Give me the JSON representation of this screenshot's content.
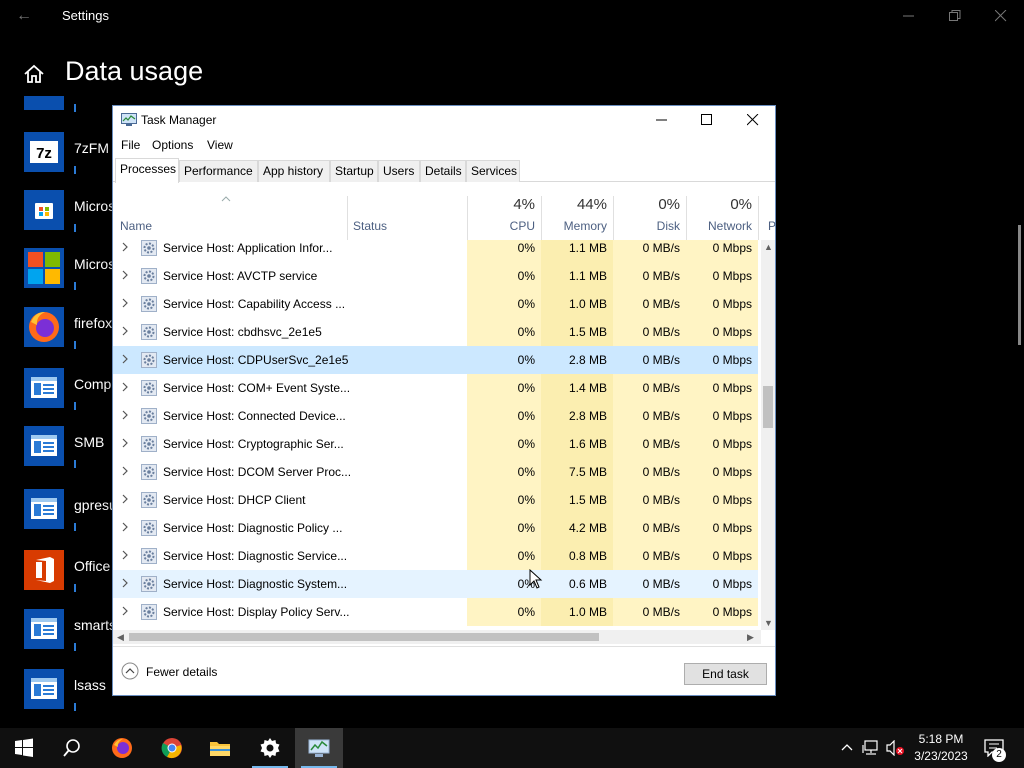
{
  "settings": {
    "title": "Settings",
    "heading": "Data usage",
    "apps": [
      {
        "name": "7zFM",
        "icon": "7zip-icon"
      },
      {
        "name": "Micros",
        "icon": "microsoft-store-icon"
      },
      {
        "name": "Micros",
        "icon": "microsoft-logo-icon"
      },
      {
        "name": "firefox",
        "icon": "firefox-icon"
      },
      {
        "name": "Comp",
        "icon": "generic-app-icon"
      },
      {
        "name": "SMB",
        "icon": "generic-app-icon"
      },
      {
        "name": "gpresu",
        "icon": "generic-app-icon"
      },
      {
        "name": "Office",
        "icon": "office-icon"
      },
      {
        "name": "smarts",
        "icon": "generic-app-icon"
      },
      {
        "name": "lsass",
        "icon": "generic-app-icon"
      }
    ]
  },
  "taskmgr": {
    "title": "Task Manager",
    "menu": [
      "File",
      "Options",
      "View"
    ],
    "tabs": [
      "Processes",
      "Performance",
      "App history",
      "Startup",
      "Users",
      "Details",
      "Services"
    ],
    "active_tab": "Processes",
    "columns": {
      "name": "Name",
      "status": "Status",
      "cpu": {
        "pct": "4%",
        "label": "CPU"
      },
      "memory": {
        "pct": "44%",
        "label": "Memory"
      },
      "disk": {
        "pct": "0%",
        "label": "Disk"
      },
      "network": {
        "pct": "0%",
        "label": "Network"
      },
      "power_partial": "P"
    },
    "rows": [
      {
        "name": "Service Host: Application Infor...",
        "cpu": "0%",
        "memory": "1.1 MB",
        "disk": "0 MB/s",
        "network": "0 Mbps"
      },
      {
        "name": "Service Host: AVCTP service",
        "cpu": "0%",
        "memory": "1.1 MB",
        "disk": "0 MB/s",
        "network": "0 Mbps"
      },
      {
        "name": "Service Host: Capability Access ...",
        "cpu": "0%",
        "memory": "1.0 MB",
        "disk": "0 MB/s",
        "network": "0 Mbps"
      },
      {
        "name": "Service Host: cbdhsvc_2e1e5",
        "cpu": "0%",
        "memory": "1.5 MB",
        "disk": "0 MB/s",
        "network": "0 Mbps"
      },
      {
        "name": "Service Host: CDPUserSvc_2e1e5",
        "cpu": "0%",
        "memory": "2.8 MB",
        "disk": "0 MB/s",
        "network": "0 Mbps",
        "state": "selected"
      },
      {
        "name": "Service Host: COM+ Event Syste...",
        "cpu": "0%",
        "memory": "1.4 MB",
        "disk": "0 MB/s",
        "network": "0 Mbps"
      },
      {
        "name": "Service Host: Connected Device...",
        "cpu": "0%",
        "memory": "2.8 MB",
        "disk": "0 MB/s",
        "network": "0 Mbps"
      },
      {
        "name": "Service Host: Cryptographic Ser...",
        "cpu": "0%",
        "memory": "1.6 MB",
        "disk": "0 MB/s",
        "network": "0 Mbps"
      },
      {
        "name": "Service Host: DCOM Server Proc...",
        "cpu": "0%",
        "memory": "7.5 MB",
        "disk": "0 MB/s",
        "network": "0 Mbps"
      },
      {
        "name": "Service Host: DHCP Client",
        "cpu": "0%",
        "memory": "1.5 MB",
        "disk": "0 MB/s",
        "network": "0 Mbps"
      },
      {
        "name": "Service Host: Diagnostic Policy ...",
        "cpu": "0%",
        "memory": "4.2 MB",
        "disk": "0 MB/s",
        "network": "0 Mbps"
      },
      {
        "name": "Service Host: Diagnostic Service...",
        "cpu": "0%",
        "memory": "0.8 MB",
        "disk": "0 MB/s",
        "network": "0 Mbps"
      },
      {
        "name": "Service Host: Diagnostic System...",
        "cpu": "0%",
        "memory": "0.6 MB",
        "disk": "0 MB/s",
        "network": "0 Mbps",
        "state": "hover"
      },
      {
        "name": "Service Host: Display Policy Serv...",
        "cpu": "0%",
        "memory": "1.0 MB",
        "disk": "0 MB/s",
        "network": "0 Mbps"
      }
    ],
    "footer": {
      "fewer_details": "Fewer details",
      "end_task": "End task"
    }
  },
  "taskbar": {
    "apps": [
      "start-icon",
      "search-icon",
      "firefox-icon",
      "chrome-icon",
      "file-explorer-icon",
      "settings-icon",
      "task-manager-icon"
    ],
    "time": "5:18 PM",
    "date": "3/23/2023",
    "notifications": "2"
  }
}
